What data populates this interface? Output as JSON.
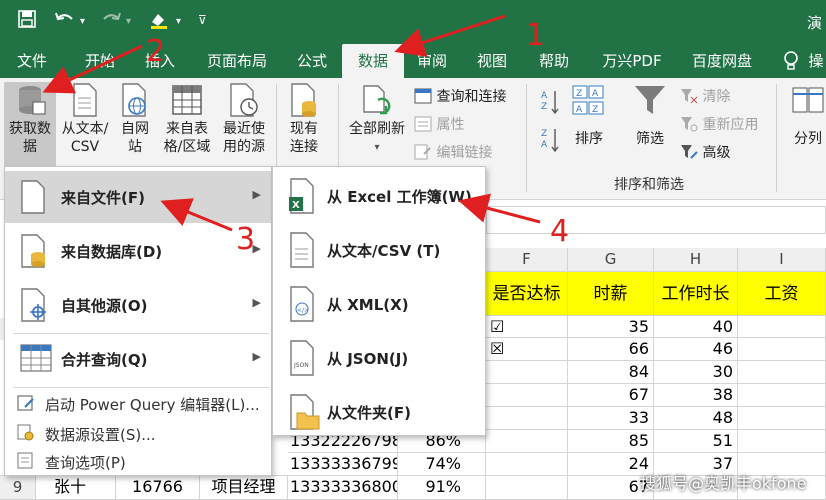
{
  "titlebar": {
    "save_icon": "save-icon",
    "undo_icon": "undo-icon",
    "redo_icon": "redo-icon",
    "format_icon": "format-painter-icon",
    "title_partial": "演"
  },
  "tabs": [
    "文件",
    "开始",
    "插入",
    "页面布局",
    "公式",
    "数据",
    "审阅",
    "视图",
    "帮助",
    "万兴PDF",
    "百度网盘",
    "操"
  ],
  "active_tab": "数据",
  "ribbon": {
    "get_data": "获取数据",
    "from_text_csv": "从文本/CSV",
    "from_web": "自网站",
    "from_table": "来自表格/区域",
    "recent_sources": "最近使用的源",
    "existing_conn": "现有连接",
    "refresh_all": "全部刷新",
    "queries_conn": "查询和连接",
    "properties": "属性",
    "edit_links": "编辑链接",
    "sort": "排序",
    "filter": "筛选",
    "clear": "清除",
    "reapply": "重新应用",
    "advanced": "高级",
    "sort_filter_group": "排序和筛选",
    "split_partial": "分列"
  },
  "menu1": {
    "from_file": "来自文件(F)",
    "from_database": "来自数据库(D)",
    "from_other": "自其他源(O)",
    "merge_query": "合并查询(Q)",
    "launch_pq": "启动 Power Query 编辑器(L)...",
    "ds_settings": "数据源设置(S)...",
    "query_options": "查询选项(P)"
  },
  "menu2": {
    "from_excel": "从 Excel 工作簿(W)",
    "from_text": "从文本/CSV (T)",
    "from_xml": "从 XML(X)",
    "from_json": "从 JSON(J)",
    "from_folder": "从文件夹(F)"
  },
  "sheet": {
    "col_headers": [
      "F",
      "G",
      "H",
      "I"
    ],
    "headers": [
      "是否达标",
      "时薪",
      "工作时长",
      "工资"
    ],
    "rows": [
      {
        "f": "☑",
        "g": "35",
        "h": "40"
      },
      {
        "f": "☒",
        "g": "66",
        "h": "46"
      },
      {
        "f": "",
        "g": "84",
        "h": "30"
      },
      {
        "f": "",
        "g": "67",
        "h": "38"
      },
      {
        "f": "",
        "g": "33",
        "h": "48"
      },
      {
        "f": "",
        "g": "85",
        "h": "51"
      },
      {
        "f": "",
        "g": "24",
        "h": "37"
      },
      {
        "f": "",
        "g": "67",
        "h": ""
      }
    ],
    "phones": [
      "13322226798",
      "13333336799",
      "13333336800"
    ],
    "pcts": [
      "86%",
      "74%",
      "91%"
    ],
    "last_row": {
      "rownum": "9",
      "name": "张十",
      "id": "16766",
      "title": "项目经理"
    },
    "row_hint": "9"
  },
  "annotations": [
    "1",
    "2",
    "3",
    "4"
  ],
  "watermark": "搜狐号@奥凯丰okfone",
  "colors": {
    "excel_green": "#217346",
    "highlight_yellow": "#ffff00",
    "annotation_red": "#e02020"
  }
}
